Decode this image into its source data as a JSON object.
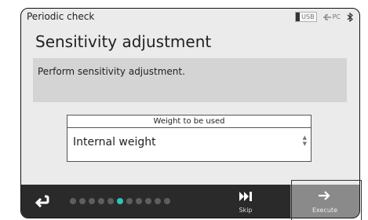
{
  "status_bar": {
    "mode_label": "Periodic check",
    "usb_label": "USB",
    "pc_label": "PC",
    "icons": [
      "usb-icon",
      "pc-connection-icon",
      "bluetooth-icon"
    ]
  },
  "title": "Sensitivity adjustment",
  "message": "Perform sensitivity adjustment.",
  "weight_select": {
    "header": "Weight to be used",
    "value": "Internal weight"
  },
  "bottom_bar": {
    "back_icon": "return-arrow-icon",
    "progress": {
      "total_steps": 11,
      "current_step": 6
    },
    "skip_label": "Skip",
    "execute_label": "Execute"
  },
  "colors": {
    "screen_bg": "#ebebeb",
    "message_bg": "#d4d4d4",
    "bar_bg": "#2a2a2a",
    "execute_bg": "#8a8a8a",
    "active_dot": "#2ec4b6",
    "inactive_dot": "#5e5e5e"
  }
}
